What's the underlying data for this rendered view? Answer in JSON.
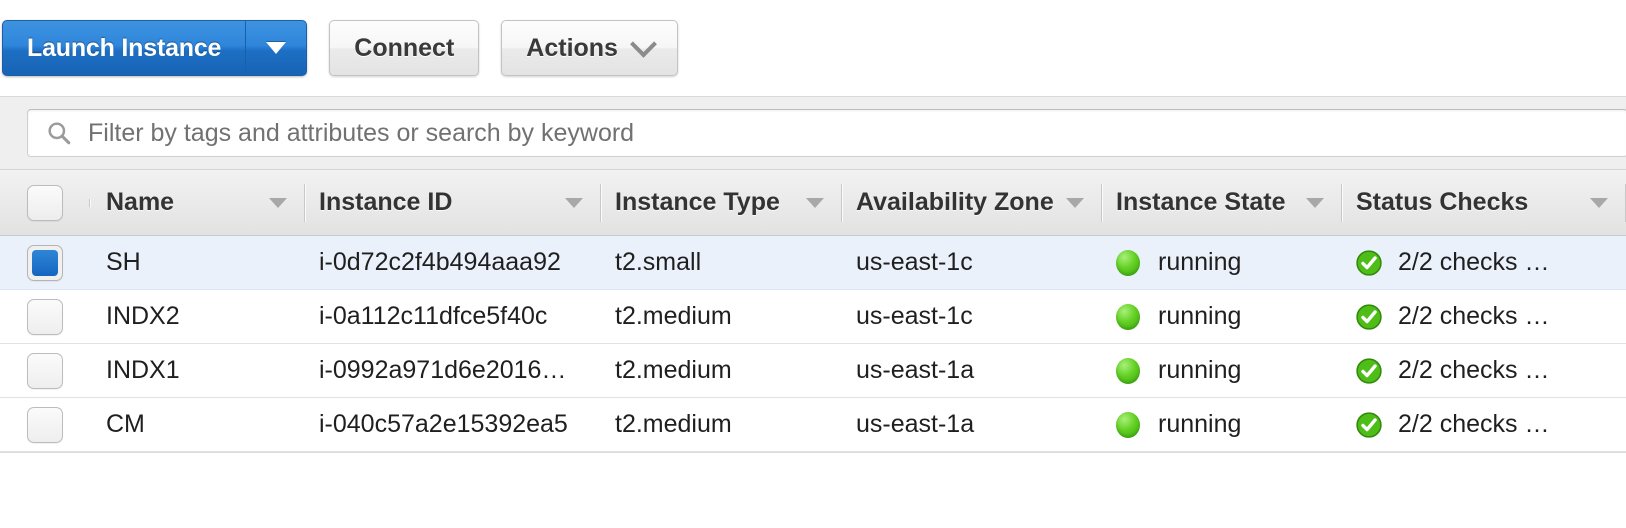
{
  "toolbar": {
    "launch_instance_label": "Launch Instance",
    "launch_dropdown_icon": "caret-down-icon",
    "connect_label": "Connect",
    "actions_label": "Actions",
    "actions_chevron_icon": "chevron-down-icon"
  },
  "filter": {
    "icon": "search-icon",
    "value": "",
    "placeholder": "Filter by tags and attributes or search by keyword"
  },
  "table": {
    "select_all_checkbox": "select-all-checkbox",
    "columns": [
      {
        "label": "Name",
        "sort_icon": "caret-down-icon"
      },
      {
        "label": "Instance ID",
        "sort_icon": "caret-down-icon"
      },
      {
        "label": "Instance Type",
        "sort_icon": "caret-down-icon"
      },
      {
        "label": "Availability Zone",
        "sort_icon": "caret-down-icon"
      },
      {
        "label": "Instance State",
        "sort_icon": "caret-down-icon"
      },
      {
        "label": "Status Checks",
        "sort_icon": "caret-down-icon"
      }
    ],
    "rows": [
      {
        "selected": true,
        "name": "SH",
        "instance_id": "i-0d72c2f4b494aaa92",
        "instance_type": "t2.small",
        "availability_zone": "us-east-1c",
        "instance_state": "running",
        "instance_state_icon": "green-circle-icon",
        "status_checks": "2/2 checks …",
        "status_checks_icon": "green-check-icon"
      },
      {
        "selected": false,
        "name": "INDX2",
        "instance_id": "i-0a112c11dfce5f40c",
        "instance_type": "t2.medium",
        "availability_zone": "us-east-1c",
        "instance_state": "running",
        "instance_state_icon": "green-circle-icon",
        "status_checks": "2/2 checks …",
        "status_checks_icon": "green-check-icon"
      },
      {
        "selected": false,
        "name": "INDX1",
        "instance_id": "i-0992a971d6e2016…",
        "instance_type": "t2.medium",
        "availability_zone": "us-east-1a",
        "instance_state": "running",
        "instance_state_icon": "green-circle-icon",
        "status_checks": "2/2 checks …",
        "status_checks_icon": "green-check-icon"
      },
      {
        "selected": false,
        "name": "CM",
        "instance_id": "i-040c57a2e15392ea5",
        "instance_type": "t2.medium",
        "availability_zone": "us-east-1a",
        "instance_state": "running",
        "instance_state_icon": "green-circle-icon",
        "status_checks": "2/2 checks …",
        "status_checks_icon": "green-check-icon"
      }
    ]
  },
  "colors": {
    "primary_button": "#2f86db",
    "selected_row": "#eaf1fb",
    "status_green": "#5bc724",
    "header_bg": "#eaeaea",
    "filter_bar_bg": "#efefef"
  }
}
